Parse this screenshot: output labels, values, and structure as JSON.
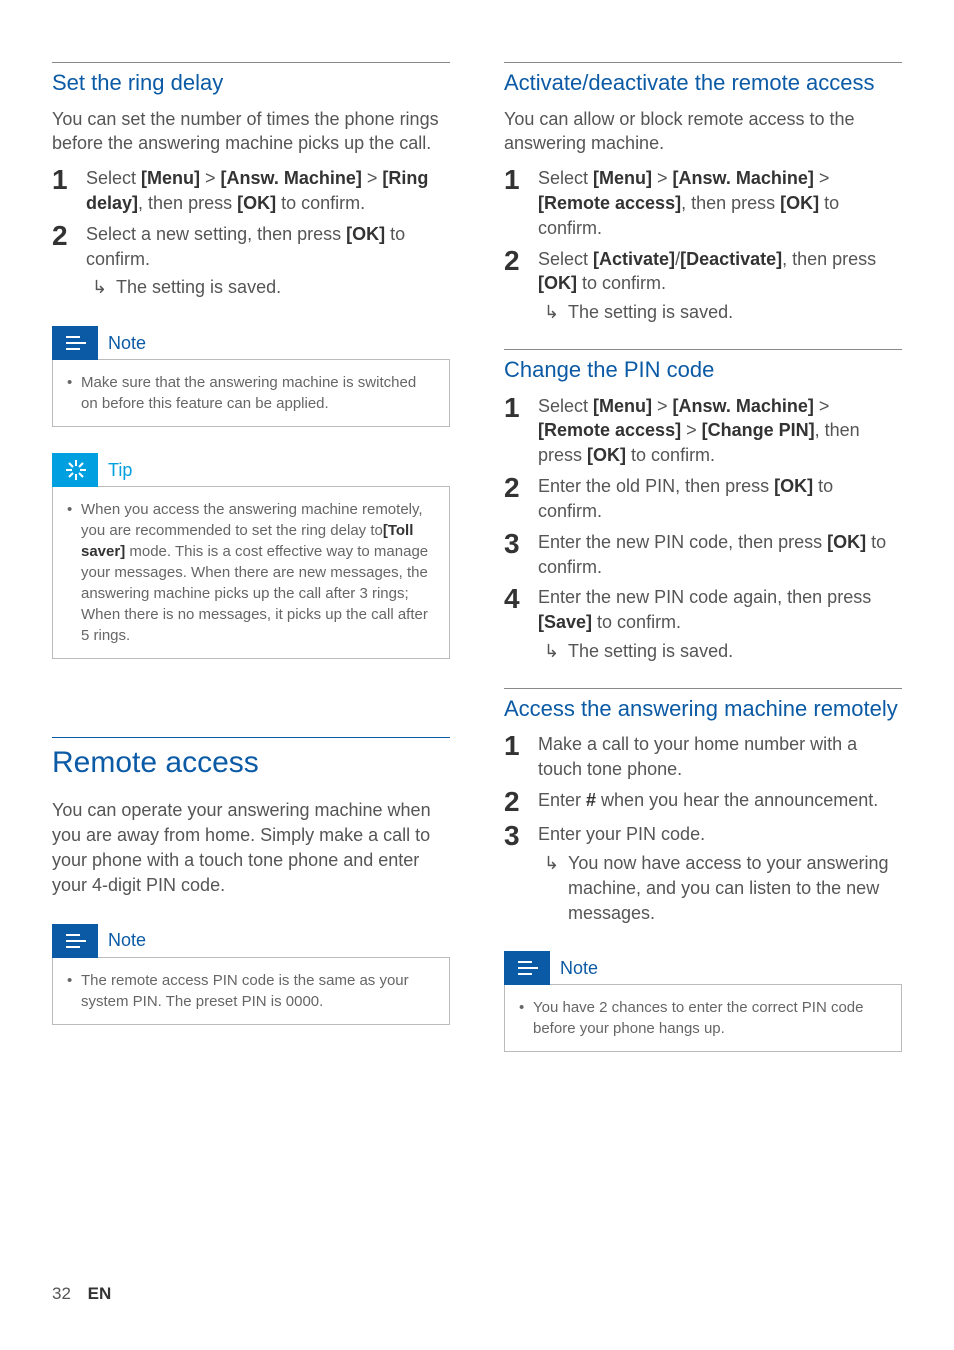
{
  "footer": {
    "page": "32",
    "lang": "EN"
  },
  "icons": {
    "note_alt": "Note",
    "tip_alt": "Tip"
  },
  "left": {
    "sec1": {
      "heading": "Set the ring delay",
      "intro": "You can set the number of times the phone rings before the answering machine picks up the call.",
      "step1_pre": "Select ",
      "step1_b1": "[Menu]",
      "step1_gt1": " > ",
      "step1_b2": "[Answ. Machine]",
      "step1_gt2": " > ",
      "step1_b3": "[Ring delay]",
      "step1_mid": ", then press ",
      "step1_b4": "[OK]",
      "step1_post": " to confirm.",
      "step2_pre": "Select a new setting, then press ",
      "step2_b1": "[OK]",
      "step2_post": " to confirm.",
      "step2_result": "The setting is saved.",
      "note_label": "Note",
      "note_text": "Make sure that the answering machine is switched on before this feature can be applied.",
      "tip_label": "Tip",
      "tip_pre": "When you access the answering machine remotely, you are recommended to set the ring delay to",
      "tip_b1": "[Toll saver]",
      "tip_post": " mode. This is a cost effective way to manage your messages. When there are new messages, the answering machine picks up the call after 3 rings; When there is no messages, it picks up the call after 5 rings."
    },
    "sec2": {
      "heading": "Remote access",
      "intro": "You can operate your answering machine when you are away from home. Simply make a call to your phone with a touch tone phone and enter your 4-digit PIN code.",
      "note_label": "Note",
      "note_text": "The remote access PIN code is the same as your system PIN. The preset PIN is 0000."
    }
  },
  "right": {
    "sec1": {
      "heading": "Activate/deactivate the remote access",
      "intro": "You can allow or block remote access to the answering machine.",
      "step1_pre": "Select ",
      "step1_b1": "[Menu]",
      "step1_gt1": " > ",
      "step1_b2": "[Answ. Machine]",
      "step1_gt2": " > ",
      "step1_b3": "[Remote access]",
      "step1_mid": ", then press ",
      "step1_b4": "[OK]",
      "step1_post": " to confirm.",
      "step2_pre": "Select ",
      "step2_b1": "[Activate]",
      "step2_slash": "/",
      "step2_b2": "[Deactivate]",
      "step2_mid": ", then press ",
      "step2_b3": "[OK]",
      "step2_post": " to confirm.",
      "step2_result": "The setting is saved."
    },
    "sec2": {
      "heading": "Change the PIN code",
      "step1_pre": "Select ",
      "step1_b1": "[Menu]",
      "step1_gt1": " > ",
      "step1_b2": "[Answ. Machine]",
      "step1_gt2": " > ",
      "step1_b3": "[Remote access]",
      "step1_gt3": " > ",
      "step1_b4": "[Change PIN]",
      "step1_mid": ", then press ",
      "step1_b5": "[OK]",
      "step1_post": " to confirm.",
      "step2_pre": "Enter the old PIN, then press ",
      "step2_b1": "[OK]",
      "step2_post": " to confirm.",
      "step3_pre": "Enter the new PIN code, then press ",
      "step3_b1": "[OK]",
      "step3_post": " to confirm.",
      "step4_pre": "Enter the new PIN code again, then press ",
      "step4_b1": "[Save]",
      "step4_post": " to confirm.",
      "step4_result": "The setting is saved."
    },
    "sec3": {
      "heading": "Access the answering machine remotely",
      "step1": "Make a call to your home number with a touch tone phone.",
      "step2_pre": "Enter ",
      "step2_b1": "#",
      "step2_post": " when you hear the announcement.",
      "step3": "Enter your PIN code.",
      "step3_result": "You now have access to your answering machine, and you can listen to the new messages.",
      "note_label": "Note",
      "note_text": "You have 2 chances to enter the correct PIN code before your phone hangs up."
    }
  }
}
